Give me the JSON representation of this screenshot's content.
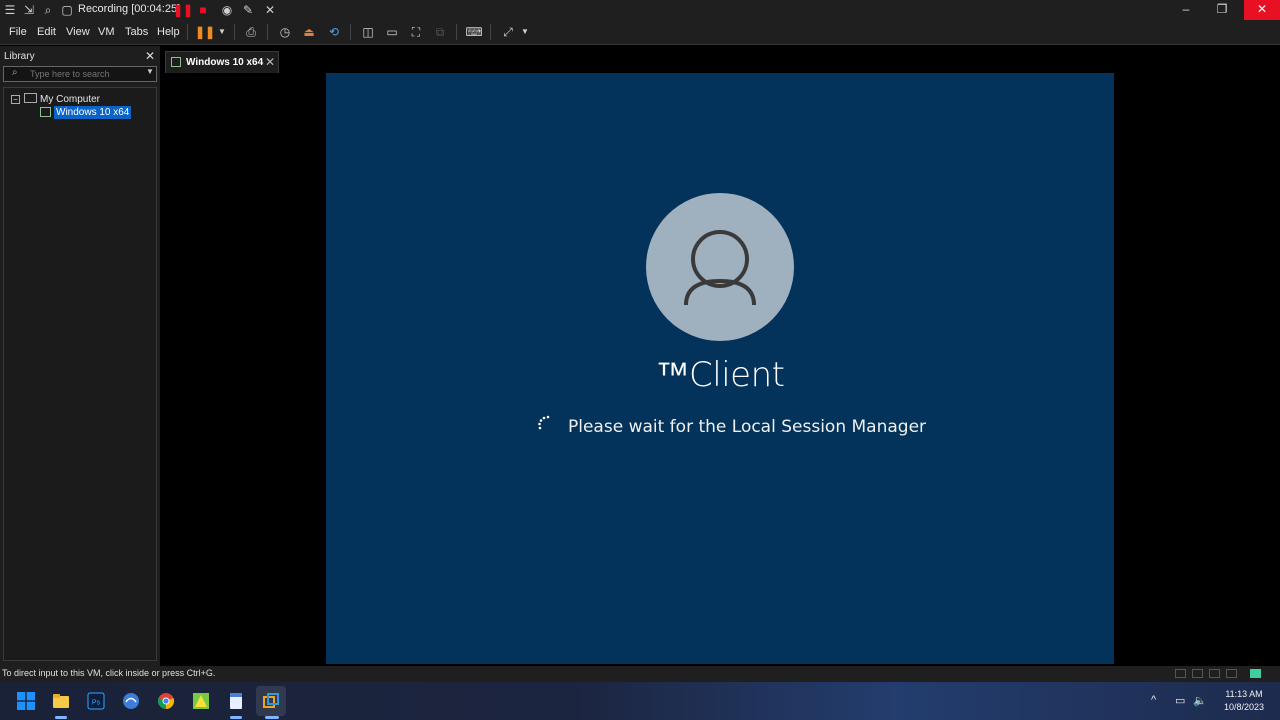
{
  "titlebar": {
    "recording_label": "Recording [00:04:25]"
  },
  "menu": {
    "items": [
      "File",
      "Edit",
      "View",
      "VM",
      "Tabs",
      "Help"
    ]
  },
  "library": {
    "title": "Library",
    "search_placeholder": "Type here to search",
    "tree": {
      "root": "My Computer",
      "child": "Windows 10 x64"
    }
  },
  "tab": {
    "label": "Windows 10 x64"
  },
  "vm": {
    "username": "™Client",
    "message": "Please wait for the Local Session Manager"
  },
  "statusbar": {
    "text": "To direct input to this VM, click inside or press Ctrl+G."
  },
  "clock": {
    "time": "11:13 AM",
    "date": "10/8/2023"
  },
  "colors": {
    "vm_background": "#03325a",
    "avatar": "#9fb0bf",
    "accent_red": "#e81123",
    "selection": "#0a64c8"
  }
}
